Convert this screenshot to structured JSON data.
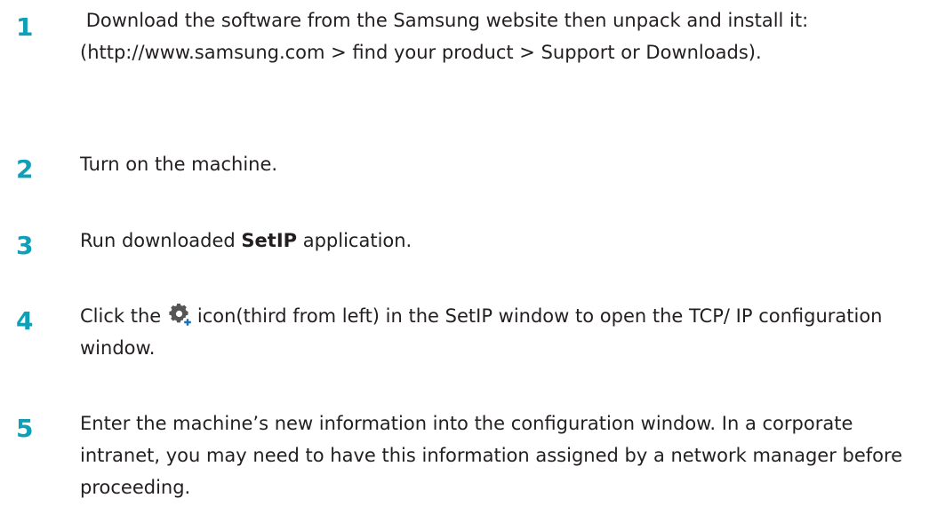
{
  "steps": [
    {
      "number": "1",
      "text": " Download the software from the Samsung website then unpack and install it: (http://www.samsung.com > find your product > Support or Downloads)."
    },
    {
      "number": "2",
      "text": "Turn on the machine."
    },
    {
      "number": "3",
      "text_before": "Run downloaded ",
      "text_bold": "SetIP",
      "text_after": " application."
    },
    {
      "number": "4",
      "text_before": "Click the",
      "icon": "gear-plus-icon",
      "text_after": "icon(third from left) in the SetIP window to open the TCP/ IP configuration window."
    },
    {
      "number": "5",
      "text": "Enter the machine’s new information into the configuration window. In a corporate intranet, you may need to have this information assigned by a network manager before proceeding."
    }
  ],
  "colors": {
    "step_number": "#0fa0b7",
    "body_text": "#231f20"
  }
}
